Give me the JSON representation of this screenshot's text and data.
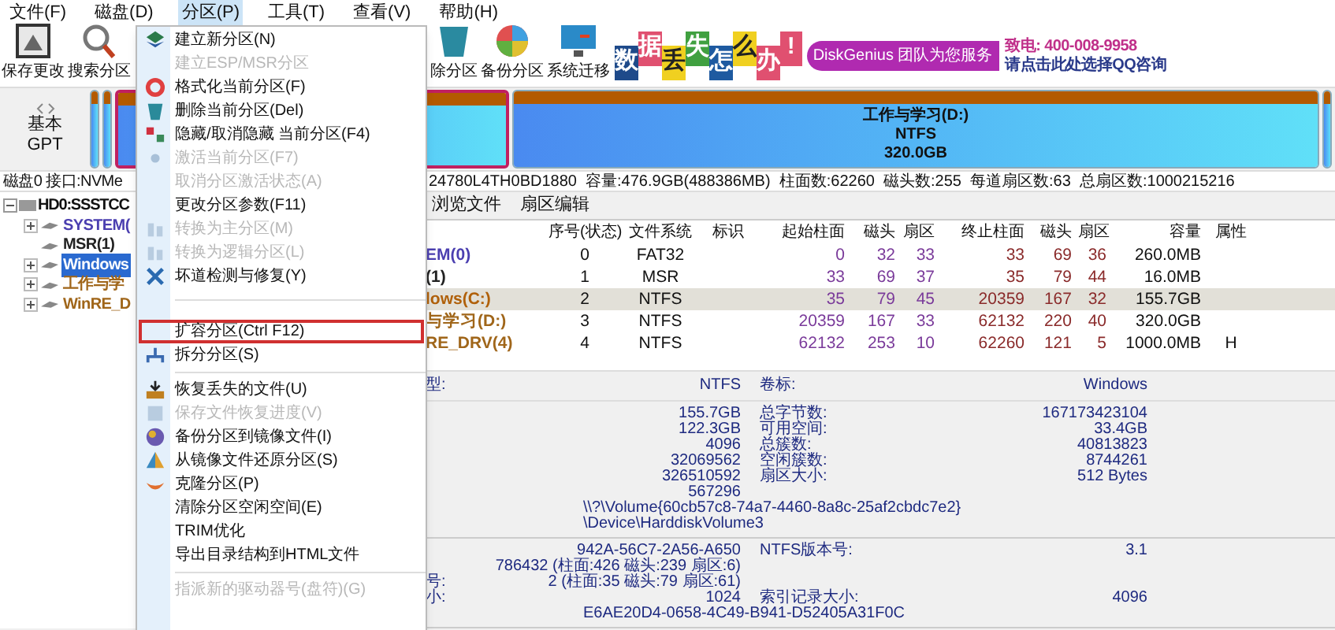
{
  "menubar": [
    {
      "label": "文件(F)",
      "selected": false
    },
    {
      "label": "磁盘(D)",
      "selected": false
    },
    {
      "label": "分区(P)",
      "selected": true
    },
    {
      "label": "工具(T)",
      "selected": false
    },
    {
      "label": "查看(V)",
      "selected": false
    },
    {
      "label": "帮助(H)",
      "selected": false
    }
  ],
  "toolbar_left": [
    {
      "label": "保存更改"
    },
    {
      "label": "搜索分区"
    }
  ],
  "toolbar_right": [
    {
      "label": "除分区"
    },
    {
      "label": "备份分区"
    },
    {
      "label": "系统迁移"
    }
  ],
  "banner": {
    "chars": [
      "数",
      "据",
      "丢",
      "失",
      "怎",
      "么",
      "办",
      "!"
    ],
    "slogan": "DiskGenius 团队为您服务",
    "phone": "致电: 400-008-9958",
    "link": "请点击此处选择QQ咨询"
  },
  "disk_map": {
    "type_lines": [
      "基本",
      "GPT"
    ],
    "partitions": [
      {
        "selected": false
      },
      {
        "selected": false
      },
      {
        "selected": true
      },
      {
        "selected": false,
        "lines": [
          "工作与学习(D:)",
          "NTFS",
          "320.0GB"
        ]
      },
      {
        "selected": false
      }
    ]
  },
  "disk_info": {
    "left": "磁盘0 接口:NVMe",
    "right": "24780L4TH0BD1880  容量:476.9GB(488386MB)  柱面数:62260  磁头数:255  每道扇区数:63  总扇区数:1000215216"
  },
  "tree": [
    {
      "label": "HD0:SSSTCC",
      "expanded": true,
      "selected": false,
      "children": [
        {
          "label": "SYSTEM(",
          "expanded": false,
          "selected": false,
          "color": "#4b3fb0"
        },
        {
          "label": "MSR(1)",
          "selected": false,
          "color": "#222222"
        },
        {
          "label": "Windows",
          "expanded": false,
          "selected": true
        },
        {
          "label": "工作与学",
          "expanded": false,
          "selected": false,
          "color": "#a0661a"
        },
        {
          "label": "WinRE_D",
          "expanded": false,
          "selected": false,
          "color": "#a0661a"
        }
      ]
    }
  ],
  "tabs": [
    {
      "label": "浏览文件",
      "selected": false
    },
    {
      "label": "扇区编辑",
      "selected": false
    }
  ],
  "table": {
    "columns": [
      "",
      "序号(状态)",
      "文件系统",
      "标识",
      "起始柱面",
      "磁头",
      "扇区",
      "终止柱面",
      "磁头",
      "扇区",
      "容量",
      "属性"
    ],
    "rows": [
      {
        "selected": false,
        "color": "#4b3fb0",
        "cells": [
          "EM(0)",
          "0",
          "FAT32",
          "",
          "0",
          "32",
          "33",
          "33",
          "69",
          "36",
          "260.0MB",
          ""
        ]
      },
      {
        "selected": false,
        "color": "#222222",
        "cells": [
          "(1)",
          "1",
          "MSR",
          "",
          "33",
          "69",
          "37",
          "35",
          "79",
          "44",
          "16.0MB",
          ""
        ]
      },
      {
        "selected": true,
        "color": "#b0600a",
        "cells": [
          "lows(C:)",
          "2",
          "NTFS",
          "",
          "35",
          "79",
          "45",
          "20359",
          "167",
          "32",
          "155.7GB",
          ""
        ]
      },
      {
        "selected": false,
        "color": "#a0661a",
        "cells": [
          "与学习(D:)",
          "3",
          "NTFS",
          "",
          "20359",
          "167",
          "33",
          "62132",
          "220",
          "40",
          "320.0GB",
          ""
        ]
      },
      {
        "selected": false,
        "color": "#a0661a",
        "cells": [
          "RE_DRV(4)",
          "4",
          "NTFS",
          "",
          "62132",
          "253",
          "10",
          "62260",
          "121",
          "5",
          "1000.0MB",
          "H"
        ]
      }
    ]
  },
  "details": [
    [
      {
        "kind": "pair",
        "label": "型:",
        "value": "NTFS",
        "label2": "卷标:",
        "value2": "Windows"
      }
    ],
    [
      {
        "kind": "pair",
        "value": "155.7GB",
        "label2": "总字节数:",
        "value2": "167173423104"
      },
      {
        "kind": "pair",
        "value": "122.3GB",
        "label2": "可用空间:",
        "value2": "33.4GB"
      },
      {
        "kind": "pair",
        "value": "4096",
        "label2": "总簇数:",
        "value2": "40813823"
      },
      {
        "kind": "pair",
        "value": "32069562",
        "label2": "空闲簇数:",
        "value2": "8744261"
      },
      {
        "kind": "pair",
        "value": "326510592",
        "label2": "扇区大小:",
        "value2": "512 Bytes"
      },
      {
        "kind": "pair",
        "value": "567296"
      },
      {
        "kind": "wide",
        "value": "\\\\?\\Volume{60cb57c8-74a7-4460-8a8c-25af2cbdc7e2}"
      },
      {
        "kind": "wide",
        "value": "\\Device\\HarddiskVolume3"
      }
    ],
    [
      {
        "kind": "pair",
        "value": "942A-56C7-2A56-A650",
        "label2": "NTFS版本号:",
        "value2": "3.1"
      },
      {
        "kind": "pair",
        "value": "786432 (柱面:426 磁头:239 扇区:6)"
      },
      {
        "kind": "pair",
        "label": "号:",
        "value": "2 (柱面:35 磁头:79 扇区:61)"
      },
      {
        "kind": "pair",
        "label": "小:",
        "value": "1024",
        "label2": "索引记录大小:",
        "value2": "4096"
      },
      {
        "kind": "wide",
        "value": "E6AE20D4-0658-4C49-B941-D52405A31F0C"
      }
    ]
  ],
  "menu": [
    {
      "kind": "item",
      "label": "建立新分区(N)",
      "disabled": false,
      "outlined": false
    },
    {
      "kind": "item",
      "label": "建立ESP/MSR分区",
      "disabled": true,
      "outlined": false
    },
    {
      "kind": "item",
      "label": "格式化当前分区(F)",
      "disabled": false,
      "outlined": false
    },
    {
      "kind": "item",
      "label": "删除当前分区(Del)",
      "disabled": false,
      "outlined": false
    },
    {
      "kind": "item",
      "label": "隐藏/取消隐藏 当前分区(F4)",
      "disabled": false,
      "outlined": false
    },
    {
      "kind": "item",
      "label": "激活当前分区(F7)",
      "disabled": true,
      "outlined": false
    },
    {
      "kind": "item",
      "label": "取消分区激活状态(A)",
      "disabled": true,
      "outlined": false
    },
    {
      "kind": "item",
      "label": "更改分区参数(F11)",
      "disabled": false,
      "outlined": false
    },
    {
      "kind": "item",
      "label": "转换为主分区(M)",
      "disabled": true,
      "outlined": false
    },
    {
      "kind": "item",
      "label": "转换为逻辑分区(L)",
      "disabled": true,
      "outlined": false
    },
    {
      "kind": "item",
      "label": "坏道检测与修复(Y)",
      "disabled": false,
      "outlined": false
    },
    {
      "kind": "gap"
    },
    {
      "kind": "item",
      "label": "扩容分区(Ctrl F12)",
      "disabled": false,
      "outlined": true
    },
    {
      "kind": "item",
      "label": "拆分分区(S)",
      "disabled": false,
      "outlined": false
    },
    {
      "kind": "separator"
    },
    {
      "kind": "item",
      "label": "恢复丢失的文件(U)",
      "disabled": false,
      "outlined": false
    },
    {
      "kind": "item",
      "label": "保存文件恢复进度(V)",
      "disabled": true,
      "outlined": false
    },
    {
      "kind": "item",
      "label": "备份分区到镜像文件(I)",
      "disabled": false,
      "outlined": false
    },
    {
      "kind": "item",
      "label": "从镜像文件还原分区(S)",
      "disabled": false,
      "outlined": false
    },
    {
      "kind": "item",
      "label": "克隆分区(P)",
      "disabled": false,
      "outlined": false
    },
    {
      "kind": "item",
      "label": "清除分区空闲空间(E)",
      "disabled": false,
      "outlined": false
    },
    {
      "kind": "item",
      "label": "TRIM优化",
      "disabled": false,
      "outlined": false
    },
    {
      "kind": "item",
      "label": "导出目录结构到HTML文件",
      "disabled": false,
      "outlined": false
    },
    {
      "kind": "separator"
    },
    {
      "kind": "item",
      "label": "指派新的驱动器号(盘符)(G)",
      "disabled": true,
      "outlined": false
    }
  ]
}
